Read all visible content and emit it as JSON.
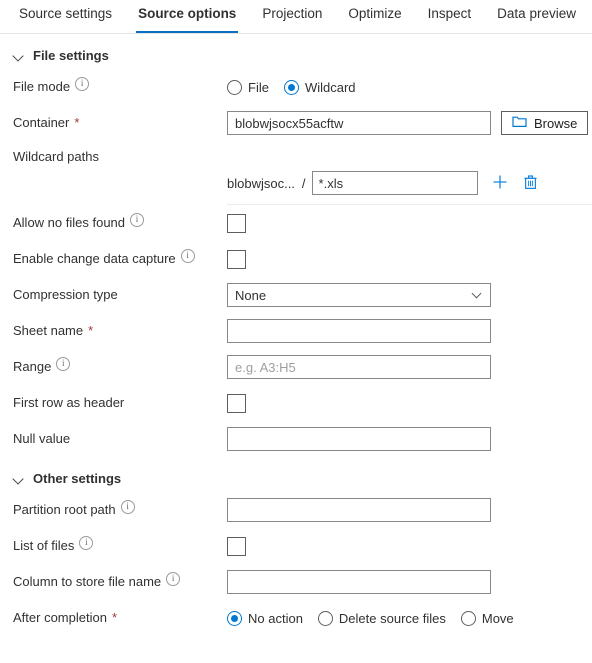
{
  "tabs": [
    {
      "label": "Source settings",
      "active": false
    },
    {
      "label": "Source options",
      "active": true
    },
    {
      "label": "Projection",
      "active": false
    },
    {
      "label": "Optimize",
      "active": false
    },
    {
      "label": "Inspect",
      "active": false
    },
    {
      "label": "Data preview",
      "active": false
    }
  ],
  "colors": {
    "accent": "#0078d4",
    "tab_underline": "#0c6fc4",
    "required_asterisk": "#a4373a",
    "label_text": "#323130",
    "placeholder": "#a19f9d",
    "border": "#8a8886"
  },
  "sections": {
    "file_settings": {
      "title": "File settings",
      "chevron": "chevron-down-icon"
    },
    "other_settings": {
      "title": "Other settings",
      "chevron": "chevron-down-icon"
    }
  },
  "fields": {
    "file_mode": {
      "label": "File mode",
      "info": "info-icon",
      "options": [
        {
          "label": "File",
          "selected": false
        },
        {
          "label": "Wildcard",
          "selected": true
        }
      ]
    },
    "container": {
      "label": "Container",
      "required": "*",
      "value": "blobwjsocx55acftw",
      "browse_label": "Browse",
      "browse_icon": "folder-icon"
    },
    "wildcard_paths": {
      "label": "Wildcard paths",
      "prefix": "blobwjsoc...",
      "separator": "/",
      "value": "*.xls",
      "add_icon": "plus-icon",
      "delete_icon": "trash-icon"
    },
    "allow_no_files_found": {
      "label": "Allow no files found",
      "info": "info-icon",
      "checked": false
    },
    "enable_change_data_capture": {
      "label": "Enable change data capture",
      "info": "info-icon",
      "checked": false
    },
    "compression_type": {
      "label": "Compression type",
      "value": "None",
      "chevron": "chevron-down-icon"
    },
    "sheet_name": {
      "label": "Sheet name",
      "required": "*",
      "value": ""
    },
    "range": {
      "label": "Range",
      "info": "info-icon",
      "value": "",
      "placeholder": "e.g. A3:H5"
    },
    "first_row_as_header": {
      "label": "First row as header",
      "checked": false
    },
    "null_value": {
      "label": "Null value",
      "value": ""
    },
    "partition_root_path": {
      "label": "Partition root path",
      "info": "info-icon",
      "value": ""
    },
    "list_of_files": {
      "label": "List of files",
      "info": "info-icon",
      "checked": false
    },
    "column_to_store_file_name": {
      "label": "Column to store file name",
      "info": "info-icon",
      "value": ""
    },
    "after_completion": {
      "label": "After completion",
      "required": "*",
      "options": [
        {
          "label": "No action",
          "selected": true
        },
        {
          "label": "Delete source files",
          "selected": false
        },
        {
          "label": "Move",
          "selected": false
        }
      ]
    }
  }
}
